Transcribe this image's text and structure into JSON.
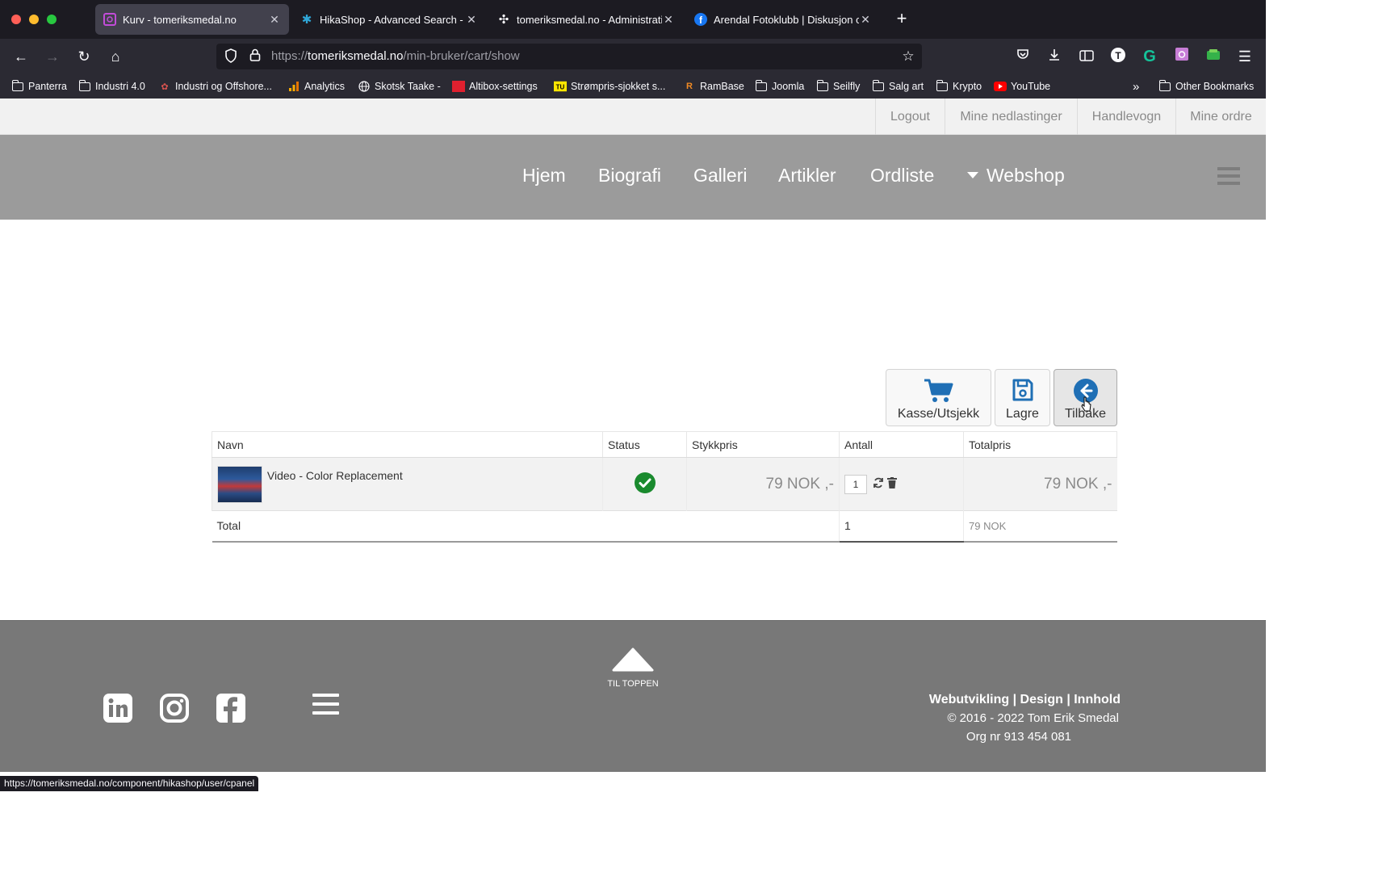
{
  "browser": {
    "tabs": [
      {
        "title": "Kurv - tomeriksmedal.no",
        "icon": "page-icon"
      },
      {
        "title": "HikaShop - Advanced Search - H",
        "icon": "hikashop-icon"
      },
      {
        "title": "tomeriksmedal.no - Administrati",
        "icon": "joomla-icon"
      },
      {
        "title": "Arendal Fotoklubb | Diskusjon o",
        "icon": "facebook-icon"
      }
    ],
    "url_scheme": "https://",
    "url_domain": "tomeriksmedal.no",
    "url_path": "/min-bruker/cart/show",
    "bookmarks": [
      {
        "label": "Panterra",
        "icon": "folder-icon"
      },
      {
        "label": "Industri 4.0",
        "icon": "folder-icon"
      },
      {
        "label": "Industri og Offshore...",
        "icon": "site-icon"
      },
      {
        "label": "Analytics",
        "icon": "analytics-icon"
      },
      {
        "label": "Skotsk Taake -",
        "icon": "globe-icon"
      },
      {
        "label": "Altibox-settings",
        "icon": "altibox-icon"
      },
      {
        "label": "Strømpris-sjokket s...",
        "icon": "tu-icon"
      },
      {
        "label": "RamBase",
        "icon": "rambase-icon"
      },
      {
        "label": "Joomla",
        "icon": "folder-icon"
      },
      {
        "label": "Seilfly",
        "icon": "folder-icon"
      },
      {
        "label": "Salg art",
        "icon": "folder-icon"
      },
      {
        "label": "Krypto",
        "icon": "folder-icon"
      },
      {
        "label": "YouTube",
        "icon": "youtube-icon"
      },
      {
        "label": "Other Bookmarks",
        "icon": "folder-icon"
      }
    ],
    "status_url": "https://tomeriksmedal.no/component/hikashop/user/cpanel"
  },
  "topbar": {
    "links": [
      "Logout",
      "Mine nedlastinger",
      "Handlevogn",
      "Mine ordre"
    ]
  },
  "mainnav": {
    "links": [
      "Hjem",
      "Biografi",
      "Galleri",
      "Artikler",
      "Ordliste"
    ],
    "webshop": "Webshop"
  },
  "cart": {
    "buttons": {
      "checkout": "Kasse/Utsjekk",
      "save": "Lagre",
      "back": "Tilbake"
    },
    "columns": [
      "Navn",
      "Status",
      "Stykkpris",
      "Antall",
      "Totalpris"
    ],
    "item": {
      "name": "Video - Color Replacement",
      "unit_price": "79 NOK ,-",
      "quantity": "1",
      "total_price": "79 NOK ,-"
    },
    "total": {
      "label": "Total",
      "quantity": "1",
      "price": "79 NOK"
    },
    "status_color": "#1a8a2e",
    "accent_color": "#1f6fb5"
  },
  "footer": {
    "totop_label": "TIL TOPPEN",
    "tagline": "Webutvikling | Design | Innhold",
    "copyright": "© 2016 - 2022 Tom Erik Smedal",
    "org": "Org nr 913 454 081",
    "social": [
      "linkedin-icon",
      "instagram-icon",
      "facebook-icon"
    ]
  }
}
